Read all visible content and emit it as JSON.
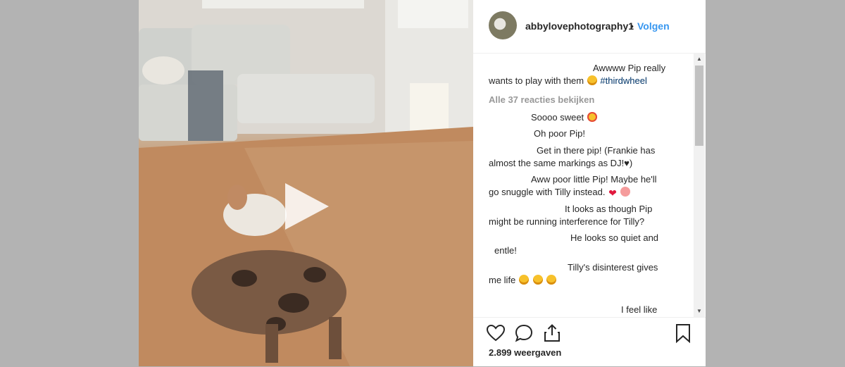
{
  "post": {
    "username": "abbylovephotography1",
    "separator": "•",
    "follow_label": "Volgen",
    "caption_line1": "Awwww Pip really",
    "caption_line2_text": "wants to play with them",
    "caption_hashtag": "#thirdwheel",
    "view_all_label": "Alle 37 reacties bekijken",
    "comments": [
      {
        "line1": "Soooo sweet",
        "line2": ""
      },
      {
        "line1": "Oh poor Pip!",
        "line2": ""
      },
      {
        "line1": "Get in there pip! (Frankie has",
        "line2": "almost the same markings as DJ!♥)"
      },
      {
        "line1": "Aww poor little Pip! Maybe he'll",
        "line2": "go snuggle with Tilly instead."
      },
      {
        "line1": "It looks as though Pip",
        "line2": "might be running interference for Tilly?"
      },
      {
        "line1": "He looks so quiet and",
        "line2": "entle!"
      },
      {
        "line1": "Tilly's disinterest gives",
        "line2": "me life"
      },
      {
        "line1": "I feel like",
        "line2": ""
      }
    ],
    "views": "2.899 weergaven"
  },
  "icons": {
    "like": "heart-icon",
    "comment": "comment-bubble-icon",
    "share": "share-icon",
    "save": "bookmark-icon",
    "play": "play-icon"
  },
  "colors": {
    "link_blue": "#3897f0",
    "hashtag": "#003569",
    "muted": "#999999"
  }
}
